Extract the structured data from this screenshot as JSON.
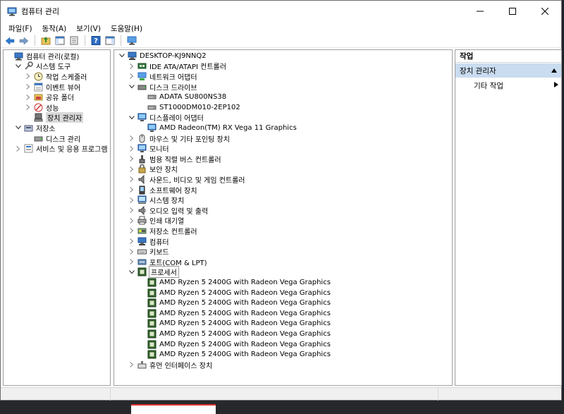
{
  "window": {
    "title": "컴퓨터 관리",
    "minimize": "—",
    "maximize": "☐",
    "close": "✕"
  },
  "menu": [
    "파일(F)",
    "동작(A)",
    "보기(V)",
    "도움말(H)"
  ],
  "left_tree": [
    {
      "label": "컴퓨터 관리(로컬)",
      "icon": "computer-management-icon",
      "level": 0,
      "chevron": ""
    },
    {
      "label": "시스템 도구",
      "icon": "tools-icon",
      "level": 1,
      "chevron": "open"
    },
    {
      "label": "작업 스케줄러",
      "icon": "clock-icon",
      "level": 2,
      "chevron": "closed"
    },
    {
      "label": "이벤트 뷰어",
      "icon": "event-viewer-icon",
      "level": 2,
      "chevron": "closed"
    },
    {
      "label": "공유 폴더",
      "icon": "shared-folder-icon",
      "level": 2,
      "chevron": "closed"
    },
    {
      "label": "성능",
      "icon": "performance-icon",
      "level": 2,
      "chevron": "closed"
    },
    {
      "label": "장치 관리자",
      "icon": "device-manager-icon",
      "level": 2,
      "chevron": "",
      "selected": true
    },
    {
      "label": "저장소",
      "icon": "storage-icon",
      "level": 1,
      "chevron": "open"
    },
    {
      "label": "디스크 관리",
      "icon": "disk-management-icon",
      "level": 2,
      "chevron": ""
    },
    {
      "label": "서비스 및 응용 프로그램",
      "icon": "services-icon",
      "level": 1,
      "chevron": "closed"
    }
  ],
  "device_tree": [
    {
      "label": "DESKTOP-KJ9NNQ2",
      "icon": "computer-icon",
      "level": 0,
      "chevron": "open"
    },
    {
      "label": "IDE ATA/ATAPI 컨트롤러",
      "icon": "controller-icon",
      "level": 1,
      "chevron": "closed"
    },
    {
      "label": "네트워크 어댑터",
      "icon": "network-icon",
      "level": 1,
      "chevron": "closed"
    },
    {
      "label": "디스크 드라이브",
      "icon": "disk-drive-icon",
      "level": 1,
      "chevron": "open"
    },
    {
      "label": "ADATA SU800NS38",
      "icon": "disk-icon",
      "level": 2,
      "chevron": ""
    },
    {
      "label": "ST1000DM010-2EP102",
      "icon": "disk-icon",
      "level": 2,
      "chevron": ""
    },
    {
      "label": "디스플레이 어댑터",
      "icon": "display-icon",
      "level": 1,
      "chevron": "open"
    },
    {
      "label": "AMD Radeon(TM) RX Vega 11 Graphics",
      "icon": "display-icon",
      "level": 2,
      "chevron": ""
    },
    {
      "label": "마우스 및 기타 포인팅 장치",
      "icon": "mouse-icon",
      "level": 1,
      "chevron": "closed"
    },
    {
      "label": "모니터",
      "icon": "monitor-icon",
      "level": 1,
      "chevron": "closed"
    },
    {
      "label": "범용 직렬 버스 컨트롤러",
      "icon": "usb-icon",
      "level": 1,
      "chevron": "closed"
    },
    {
      "label": "보안 장치",
      "icon": "security-icon",
      "level": 1,
      "chevron": "closed"
    },
    {
      "label": "사운드, 비디오 및 게임 컨트롤러",
      "icon": "sound-icon",
      "level": 1,
      "chevron": "closed"
    },
    {
      "label": "소프트웨어 장치",
      "icon": "software-device-icon",
      "level": 1,
      "chevron": "closed"
    },
    {
      "label": "시스템 장치",
      "icon": "system-device-icon",
      "level": 1,
      "chevron": "closed"
    },
    {
      "label": "오디오 입력 및 출력",
      "icon": "audio-icon",
      "level": 1,
      "chevron": "closed"
    },
    {
      "label": "인쇄 대기열",
      "icon": "printer-icon",
      "level": 1,
      "chevron": "closed"
    },
    {
      "label": "저장소 컨트롤러",
      "icon": "storage-controller-icon",
      "level": 1,
      "chevron": "closed"
    },
    {
      "label": "컴퓨터",
      "icon": "computer-icon",
      "level": 1,
      "chevron": "closed"
    },
    {
      "label": "키보드",
      "icon": "keyboard-icon",
      "level": 1,
      "chevron": "closed"
    },
    {
      "label": "포트(COM & LPT)",
      "icon": "port-icon",
      "level": 1,
      "chevron": "closed"
    },
    {
      "label": "프로세서",
      "icon": "processor-icon",
      "level": 1,
      "chevron": "open",
      "focused": true
    },
    {
      "label": "AMD Ryzen 5 2400G with Radeon Vega Graphics",
      "icon": "processor-icon",
      "level": 2,
      "chevron": ""
    },
    {
      "label": "AMD Ryzen 5 2400G with Radeon Vega Graphics",
      "icon": "processor-icon",
      "level": 2,
      "chevron": ""
    },
    {
      "label": "AMD Ryzen 5 2400G with Radeon Vega Graphics",
      "icon": "processor-icon",
      "level": 2,
      "chevron": ""
    },
    {
      "label": "AMD Ryzen 5 2400G with Radeon Vega Graphics",
      "icon": "processor-icon",
      "level": 2,
      "chevron": ""
    },
    {
      "label": "AMD Ryzen 5 2400G with Radeon Vega Graphics",
      "icon": "processor-icon",
      "level": 2,
      "chevron": ""
    },
    {
      "label": "AMD Ryzen 5 2400G with Radeon Vega Graphics",
      "icon": "processor-icon",
      "level": 2,
      "chevron": ""
    },
    {
      "label": "AMD Ryzen 5 2400G with Radeon Vega Graphics",
      "icon": "processor-icon",
      "level": 2,
      "chevron": ""
    },
    {
      "label": "AMD Ryzen 5 2400G with Radeon Vega Graphics",
      "icon": "processor-icon",
      "level": 2,
      "chevron": ""
    },
    {
      "label": "휴먼 인터페이스 장치",
      "icon": "hid-icon",
      "level": 1,
      "chevron": "closed"
    }
  ],
  "actions": {
    "header": "작업",
    "section": "장치 관리자",
    "item": "기타 작업"
  },
  "colors": {
    "selection": "#d9d9d9",
    "action_section": "#c9dcf0"
  }
}
